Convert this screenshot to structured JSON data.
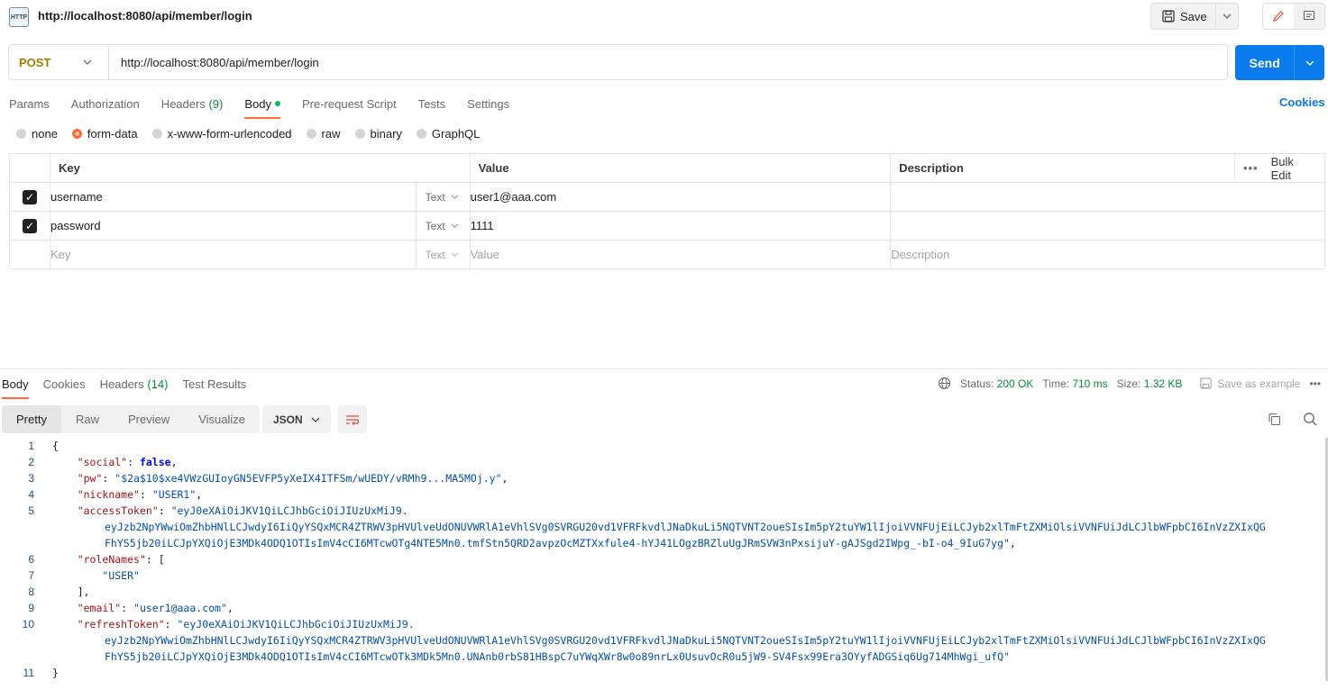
{
  "header": {
    "title": "http://localhost:8080/api/member/login",
    "save_label": "Save"
  },
  "request": {
    "method": "POST",
    "url": "http://localhost:8080/api/member/login",
    "send_label": "Send"
  },
  "tabs": [
    {
      "label": "Params"
    },
    {
      "label": "Authorization"
    },
    {
      "label": "Headers",
      "count": "(9)"
    },
    {
      "label": "Body"
    },
    {
      "label": "Pre-request Script"
    },
    {
      "label": "Tests"
    },
    {
      "label": "Settings"
    }
  ],
  "cookies_label": "Cookies",
  "body_types": [
    "none",
    "form-data",
    "x-www-form-urlencoded",
    "raw",
    "binary",
    "GraphQL"
  ],
  "selected_body_type": "form-data",
  "table": {
    "headers": {
      "key": "Key",
      "value": "Value",
      "description": "Description",
      "bulk_edit": "Bulk Edit"
    },
    "rows": [
      {
        "checked": true,
        "key": "username",
        "type": "Text",
        "value": "user1@aaa.com",
        "description": ""
      },
      {
        "checked": true,
        "key": "password",
        "type": "Text",
        "value": "1111",
        "description": ""
      }
    ],
    "placeholder": {
      "key": "Key",
      "type": "Text",
      "value": "Value",
      "description": "Description"
    }
  },
  "response": {
    "tabs": [
      {
        "label": "Body"
      },
      {
        "label": "Cookies"
      },
      {
        "label": "Headers",
        "count": "(14)"
      },
      {
        "label": "Test Results"
      }
    ],
    "status_label": "Status:",
    "status_value": "200 OK",
    "time_label": "Time:",
    "time_value": "710 ms",
    "size_label": "Size:",
    "size_value": "1.32 KB",
    "save_example": "Save as example",
    "more": "ooo",
    "view_modes": [
      "Pretty",
      "Raw",
      "Preview",
      "Visualize"
    ],
    "format": "JSON",
    "lines": [
      {
        "n": "1",
        "text": "{"
      },
      {
        "n": "2",
        "key": "\"social\"",
        "val": "false",
        "kind": "bool",
        "tail": ","
      },
      {
        "n": "3",
        "key": "\"pw\"",
        "val": "\"$2a$10$xe4VWzGUIoyGN5EVFP5yXeIX4ITFSm/wUEDY/vRMh9...MA5MOj.y\"",
        "kind": "str",
        "tail": ","
      },
      {
        "n": "4",
        "key": "\"nickname\"",
        "val": "\"USER1\"",
        "kind": "str",
        "tail": ","
      },
      {
        "n": "5",
        "key": "\"accessToken\"",
        "val": "\"eyJ0eXAiOiJKV1QiLCJhbGciOiJIUzUxMiJ9.",
        "kind": "str",
        "tail": ""
      },
      {
        "n": "",
        "cont": "eyJzb2NpYWwiOmZhbHNlLCJwdyI6IiQyYSQxMCR4ZTRWV3pHVUlveUdONUVWRlA1eVhlSVg0SVRGU20vd1VFRFkvdlJNaDkuLi5NQTVNT2oueSIsIm5pY2tuYW1lIjoiVVNFUjEiLCJyb2xlTmFtZXMiOlsiVVNFUiJdLCJlbWFpbCI6InVzZXIxQG"
      },
      {
        "n": "",
        "cont": "FhYS5jb20iLCJpYXQiOjE3MDk4ODQ1OTIsImV4cCI6MTcwOTg4NTE5Mn0.tmfStn5QRD2avpzOcMZTXxfule4-hYJ41LOgzBRZluUgJRmSVW3nPxsijuY-gAJSgd2IWpg_-bI-o4_9IuG7yg\"",
        "tail": ","
      },
      {
        "n": "6",
        "key": "\"roleNames\"",
        "val": "[",
        "kind": "plain",
        "tail": ""
      },
      {
        "n": "7",
        "indent2": "\"USER\""
      },
      {
        "n": "8",
        "text": "    ],"
      },
      {
        "n": "9",
        "key": "\"email\"",
        "val": "\"user1@aaa.com\"",
        "kind": "str",
        "tail": ","
      },
      {
        "n": "10",
        "key": "\"refreshToken\"",
        "val": "\"eyJ0eXAiOiJKV1QiLCJhbGciOiJIUzUxMiJ9.",
        "kind": "str",
        "tail": ""
      },
      {
        "n": "",
        "cont": "eyJzb2NpYWwiOmZhbHNlLCJwdyI6IiQyYSQxMCR4ZTRWV3pHVUlveUdONUVWRlA1eVhlSVg0SVRGU20vd1VFRFkvdlJNaDkuLi5NQTVNT2oueSIsIm5pY2tuYW1lIjoiVVNFUjEiLCJyb2xlTmFtZXMiOlsiVVNFUiJdLCJlbWFpbCI6InVzZXIxQG"
      },
      {
        "n": "",
        "cont": "FhYS5jb20iLCJpYXQiOjE3MDk4ODQ1OTIsImV4cCI6MTcwOTk3MDk5Mn0.UNAnb0rbS81HBspC7uYWqXWr8w0o89nrLx0UsuvOcR0u5jW9-SV4Fsx99Era3OYyfADGSiq6Ug714MhWgi_ufQ\"",
        "tail": ""
      },
      {
        "n": "11",
        "text": "}"
      }
    ]
  }
}
